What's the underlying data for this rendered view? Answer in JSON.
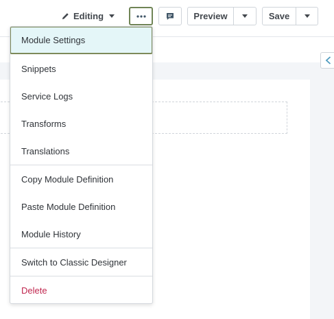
{
  "toolbar": {
    "editing_label": "Editing",
    "preview_label": "Preview",
    "save_label": "Save"
  },
  "menu": {
    "items": [
      {
        "label": "Module Settings",
        "active": true
      },
      {
        "label": "Snippets"
      },
      {
        "label": "Service Logs"
      },
      {
        "label": "Transforms"
      },
      {
        "label": "Translations"
      },
      {
        "label": "Copy Module Definition"
      },
      {
        "label": "Paste Module Definition"
      },
      {
        "label": "Module History"
      },
      {
        "label": "Switch to Classic Designer"
      },
      {
        "label": "Delete",
        "danger": true
      }
    ]
  },
  "colors": {
    "active_item_bg": "#e4f6f8",
    "active_outline": "#7d8a5a",
    "danger_text": "#c0264e",
    "accent_blue": "#4f9bbf"
  },
  "icons": {
    "editing": "pencil-icon",
    "more": "ellipsis-icon",
    "comment": "comment-icon",
    "dropdown": "caret-down-icon",
    "collapse": "chevron-left-icon"
  }
}
